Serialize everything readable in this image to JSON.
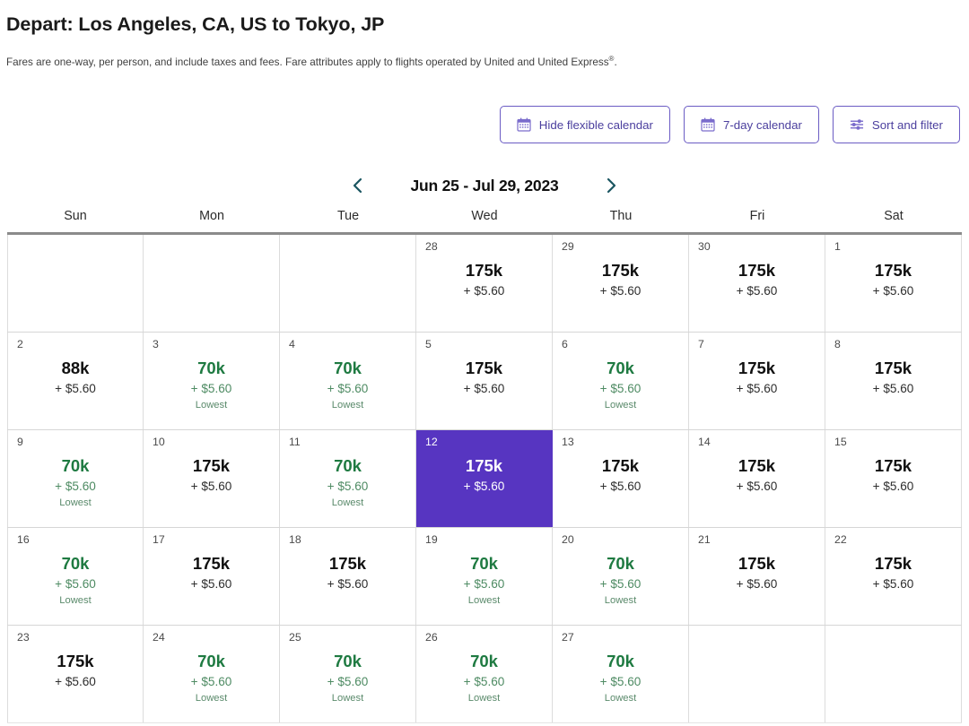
{
  "header": {
    "title": "Depart: Los Angeles, CA, US to Tokyo, JP",
    "subtitle_part1": "Fares are one-way, per person, and include taxes and fees. Fare attributes apply to flights operated by United and United Express",
    "subtitle_sup": "®",
    "subtitle_end": "."
  },
  "toolbar": {
    "hide_flexible_calendar": "Hide flexible calendar",
    "seven_day_calendar": "7-day calendar",
    "sort_and_filter": "Sort and filter",
    "icons": {
      "hide_flexible_calendar": "calendar-icon",
      "seven_day_calendar": "calendar-icon",
      "sort_and_filter": "sliders-icon"
    },
    "accent_color": "#6b5cc4"
  },
  "date_nav": {
    "prev_label": "‹",
    "prev_icon": "chevron-left-icon",
    "next_icon": "chevron-right-icon",
    "range": "Jun 25 - Jul 29, 2023",
    "arrow_color": "#1a5560"
  },
  "calendar": {
    "weekdays": [
      "Sun",
      "Mon",
      "Tue",
      "Wed",
      "Thu",
      "Fri",
      "Sat"
    ],
    "selected_color": "#5735c1",
    "lowest_label": "Lowest",
    "rows": [
      [
        {
          "day": "",
          "miles": "",
          "tax": "",
          "lowest": false,
          "empty": true,
          "selected": false
        },
        {
          "day": "",
          "miles": "",
          "tax": "",
          "lowest": false,
          "empty": true,
          "selected": false
        },
        {
          "day": "",
          "miles": "",
          "tax": "",
          "lowest": false,
          "empty": true,
          "selected": false
        },
        {
          "day": "28",
          "miles": "175k",
          "tax": "+ $5.60",
          "lowest": false,
          "empty": false,
          "selected": false
        },
        {
          "day": "29",
          "miles": "175k",
          "tax": "+ $5.60",
          "lowest": false,
          "empty": false,
          "selected": false
        },
        {
          "day": "30",
          "miles": "175k",
          "tax": "+ $5.60",
          "lowest": false,
          "empty": false,
          "selected": false
        },
        {
          "day": "1",
          "miles": "175k",
          "tax": "+ $5.60",
          "lowest": false,
          "empty": false,
          "selected": false
        }
      ],
      [
        {
          "day": "2",
          "miles": "88k",
          "tax": "+ $5.60",
          "lowest": false,
          "empty": false,
          "selected": false
        },
        {
          "day": "3",
          "miles": "70k",
          "tax": "+ $5.60",
          "lowest": true,
          "empty": false,
          "selected": false
        },
        {
          "day": "4",
          "miles": "70k",
          "tax": "+ $5.60",
          "lowest": true,
          "empty": false,
          "selected": false
        },
        {
          "day": "5",
          "miles": "175k",
          "tax": "+ $5.60",
          "lowest": false,
          "empty": false,
          "selected": false
        },
        {
          "day": "6",
          "miles": "70k",
          "tax": "+ $5.60",
          "lowest": true,
          "empty": false,
          "selected": false
        },
        {
          "day": "7",
          "miles": "175k",
          "tax": "+ $5.60",
          "lowest": false,
          "empty": false,
          "selected": false
        },
        {
          "day": "8",
          "miles": "175k",
          "tax": "+ $5.60",
          "lowest": false,
          "empty": false,
          "selected": false
        }
      ],
      [
        {
          "day": "9",
          "miles": "70k",
          "tax": "+ $5.60",
          "lowest": true,
          "empty": false,
          "selected": false
        },
        {
          "day": "10",
          "miles": "175k",
          "tax": "+ $5.60",
          "lowest": false,
          "empty": false,
          "selected": false
        },
        {
          "day": "11",
          "miles": "70k",
          "tax": "+ $5.60",
          "lowest": true,
          "empty": false,
          "selected": false
        },
        {
          "day": "12",
          "miles": "175k",
          "tax": "+ $5.60",
          "lowest": false,
          "empty": false,
          "selected": true
        },
        {
          "day": "13",
          "miles": "175k",
          "tax": "+ $5.60",
          "lowest": false,
          "empty": false,
          "selected": false
        },
        {
          "day": "14",
          "miles": "175k",
          "tax": "+ $5.60",
          "lowest": false,
          "empty": false,
          "selected": false
        },
        {
          "day": "15",
          "miles": "175k",
          "tax": "+ $5.60",
          "lowest": false,
          "empty": false,
          "selected": false
        }
      ],
      [
        {
          "day": "16",
          "miles": "70k",
          "tax": "+ $5.60",
          "lowest": true,
          "empty": false,
          "selected": false
        },
        {
          "day": "17",
          "miles": "175k",
          "tax": "+ $5.60",
          "lowest": false,
          "empty": false,
          "selected": false
        },
        {
          "day": "18",
          "miles": "175k",
          "tax": "+ $5.60",
          "lowest": false,
          "empty": false,
          "selected": false
        },
        {
          "day": "19",
          "miles": "70k",
          "tax": "+ $5.60",
          "lowest": true,
          "empty": false,
          "selected": false
        },
        {
          "day": "20",
          "miles": "70k",
          "tax": "+ $5.60",
          "lowest": true,
          "empty": false,
          "selected": false
        },
        {
          "day": "21",
          "miles": "175k",
          "tax": "+ $5.60",
          "lowest": false,
          "empty": false,
          "selected": false
        },
        {
          "day": "22",
          "miles": "175k",
          "tax": "+ $5.60",
          "lowest": false,
          "empty": false,
          "selected": false
        }
      ],
      [
        {
          "day": "23",
          "miles": "175k",
          "tax": "+ $5.60",
          "lowest": false,
          "empty": false,
          "selected": false
        },
        {
          "day": "24",
          "miles": "70k",
          "tax": "+ $5.60",
          "lowest": true,
          "empty": false,
          "selected": false
        },
        {
          "day": "25",
          "miles": "70k",
          "tax": "+ $5.60",
          "lowest": true,
          "empty": false,
          "selected": false
        },
        {
          "day": "26",
          "miles": "70k",
          "tax": "+ $5.60",
          "lowest": true,
          "empty": false,
          "selected": false
        },
        {
          "day": "27",
          "miles": "70k",
          "tax": "+ $5.60",
          "lowest": true,
          "empty": false,
          "selected": false
        },
        {
          "day": "",
          "miles": "",
          "tax": "",
          "lowest": false,
          "empty": true,
          "selected": false
        },
        {
          "day": "",
          "miles": "",
          "tax": "",
          "lowest": false,
          "empty": true,
          "selected": false
        }
      ]
    ]
  }
}
